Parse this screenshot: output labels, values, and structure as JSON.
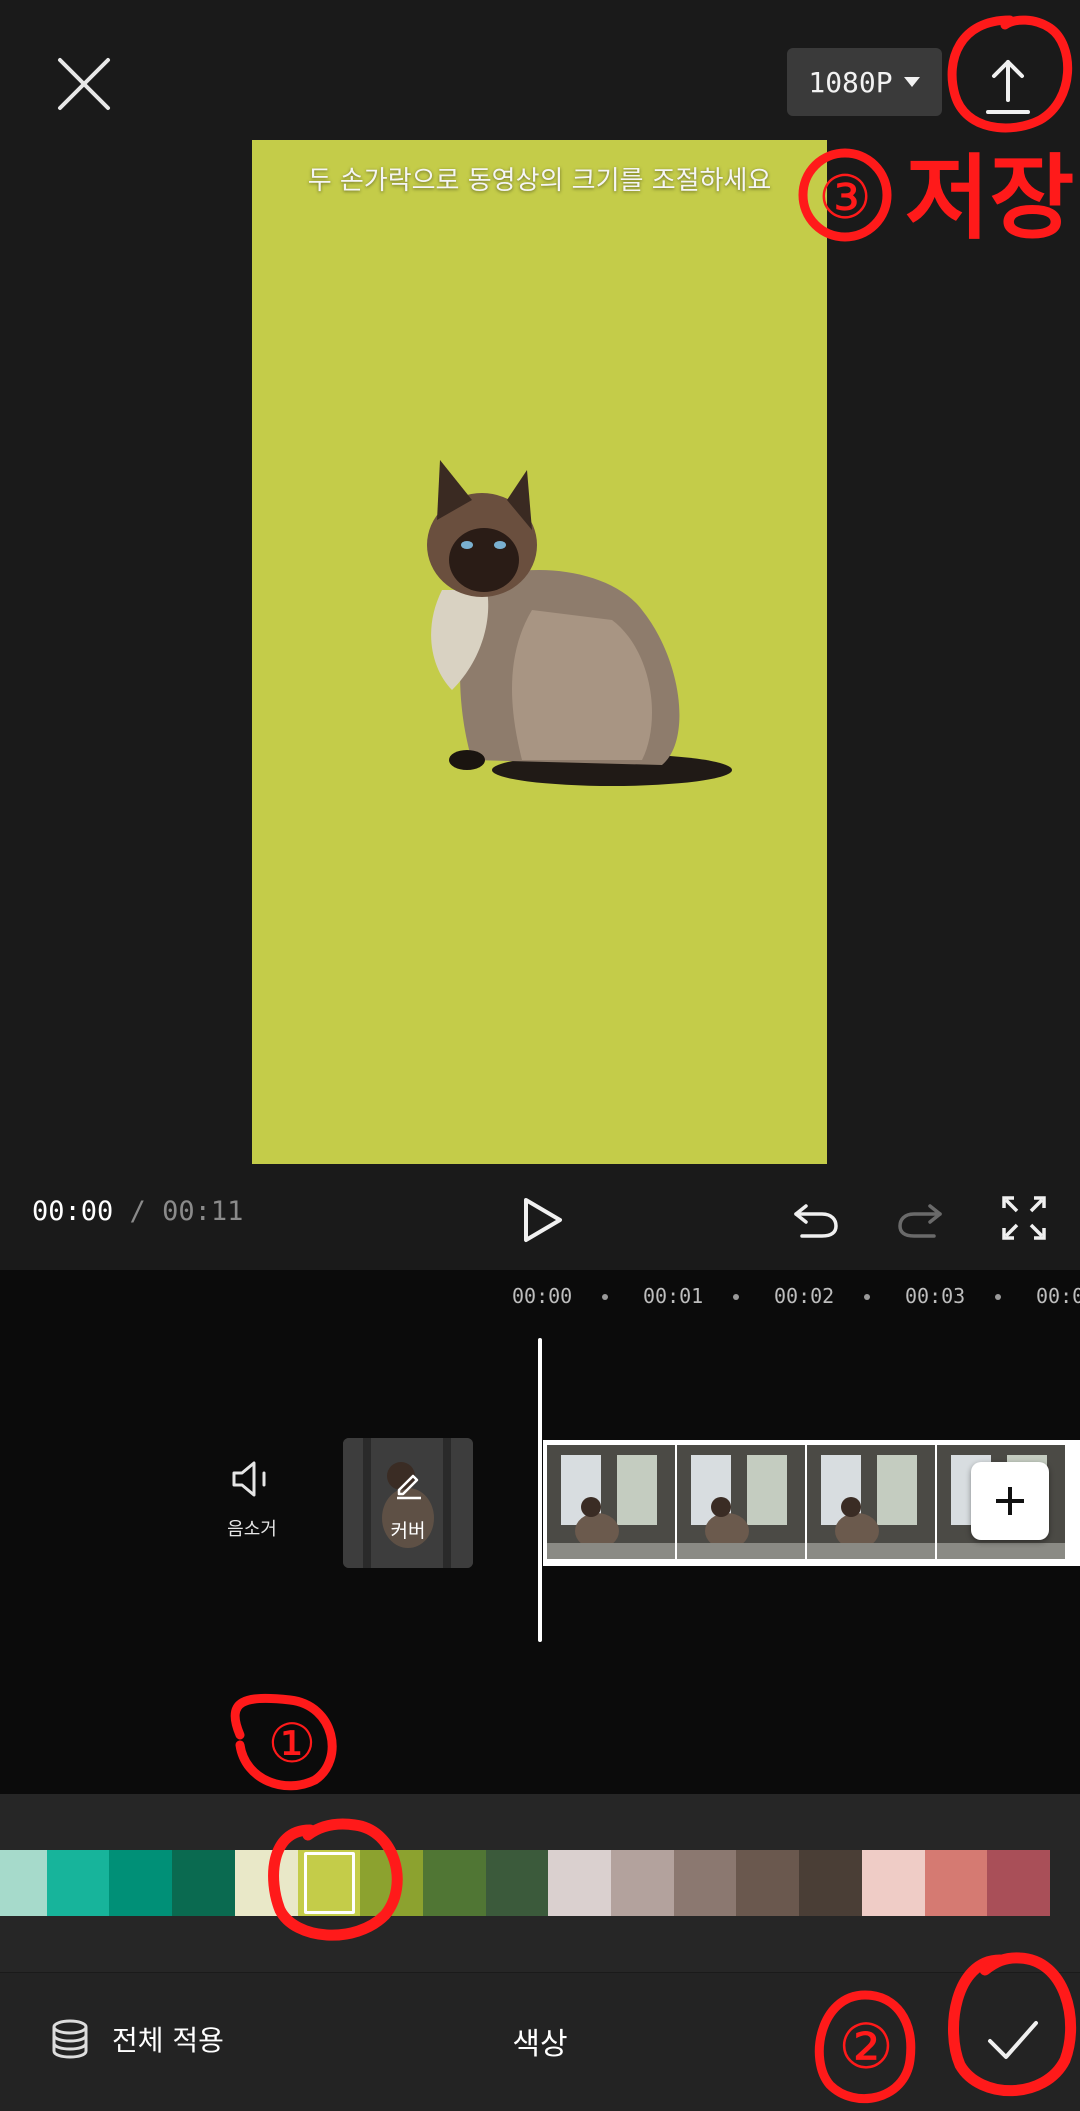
{
  "top_bar": {
    "close_icon": "close-icon",
    "resolution": "1080P",
    "export_icon": "upload-icon"
  },
  "preview": {
    "background_color": "#c4cc49",
    "hint": "두 손가락으로 동영상의 크기를 조절하세요"
  },
  "playback": {
    "current_time": "00:00",
    "separator": "/",
    "total_time": "00:11"
  },
  "timeline": {
    "ruler": [
      "00:00",
      "00:01",
      "00:02",
      "00:03",
      "00:0"
    ],
    "mute_label": "음소거",
    "cover_label": "커버"
  },
  "palette": {
    "colors": [
      "#a6dacb",
      "#17b49b",
      "#009077",
      "#0a6a50",
      "#e9e8c8",
      "#c4cc49",
      "#8ca22f",
      "#507634",
      "#3b5a3b",
      "#dad0cf",
      "#b3a29d",
      "#8b7870",
      "#6a584e",
      "#4a3e36",
      "#efccc6",
      "#d57a72",
      "#a94f58"
    ],
    "selected_index": 5
  },
  "bottom_bar": {
    "apply_all": "전체 적용",
    "title": "색상"
  },
  "annotations": {
    "step1": "①",
    "step2": "②",
    "step3": "③",
    "save": "저장"
  },
  "colors": {
    "background": "#1a1a1a",
    "timeline_bg": "#0b0b0b",
    "annotation": "#ff1a1a"
  }
}
